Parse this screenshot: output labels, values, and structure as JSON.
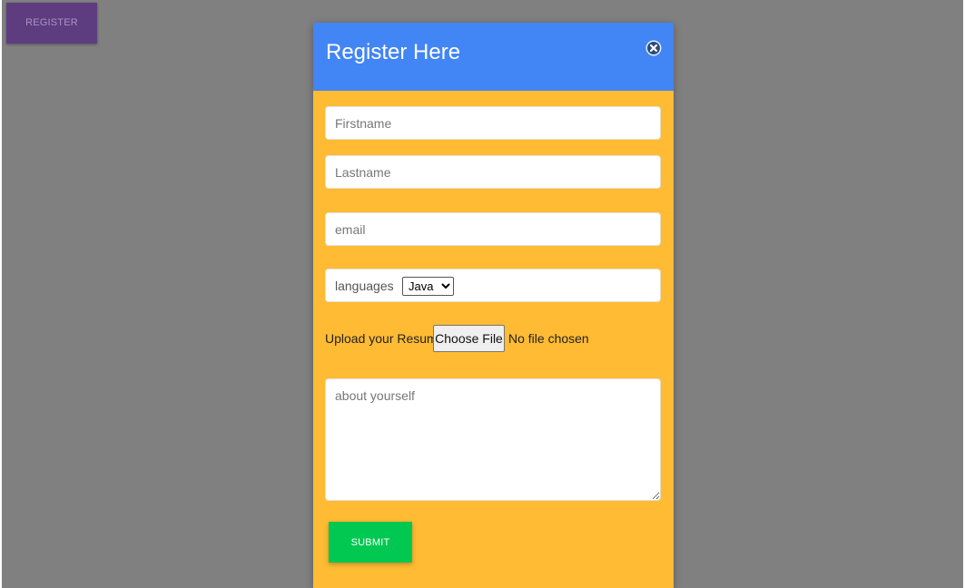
{
  "page": {
    "register_button_label": "REGISTER"
  },
  "modal": {
    "title": "Register Here",
    "close_icon": "close-circle-icon"
  },
  "form": {
    "firstname": {
      "value": "",
      "placeholder": "Firstname"
    },
    "lastname": {
      "value": "",
      "placeholder": "Lastname"
    },
    "email": {
      "value": "",
      "placeholder": "email"
    },
    "languages": {
      "label": "languages",
      "selected": "Java",
      "options": [
        "Java"
      ]
    },
    "resume": {
      "label": "Upload your Resume",
      "button_label": "Choose File",
      "status": "No file chosen"
    },
    "about": {
      "value": "",
      "placeholder": "about yourself"
    },
    "submit_label": "SUBMIT"
  },
  "colors": {
    "backdrop": "#808080",
    "register_button": "#5e3c80",
    "modal_header": "#4285f4",
    "modal_body": "#ffbb33",
    "submit_button": "#00c851"
  }
}
